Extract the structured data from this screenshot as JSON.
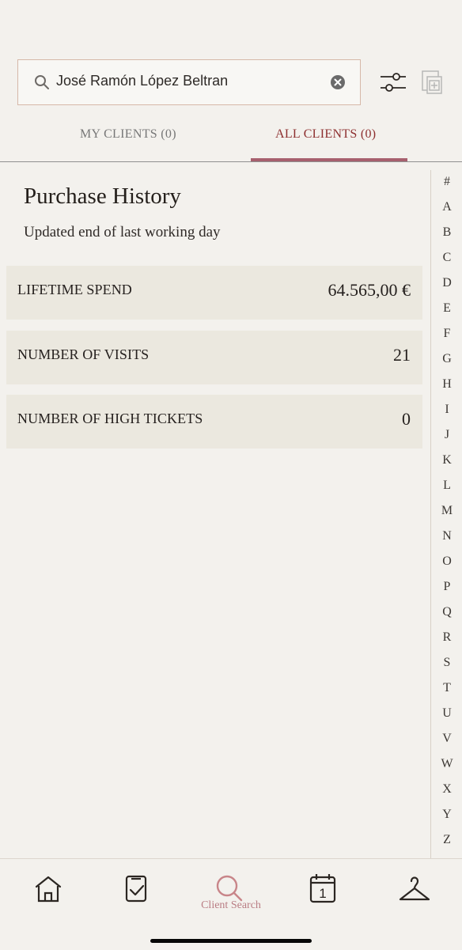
{
  "search": {
    "value": "José Ramón López Beltran"
  },
  "tabs": {
    "my_clients": "MY CLIENTS (0)",
    "all_clients": "ALL CLIENTS (0)"
  },
  "purchase_history": {
    "title": "Purchase History",
    "subtitle": "Updated end of last working day",
    "items": [
      {
        "label": "LIFETIME SPEND",
        "value": "64.565,00 €"
      },
      {
        "label": "NUMBER OF VISITS",
        "value": "21"
      },
      {
        "label": "NUMBER OF HIGH TICKETS",
        "value": "0"
      }
    ]
  },
  "alphabet_index": [
    "#",
    "A",
    "B",
    "C",
    "D",
    "E",
    "F",
    "G",
    "H",
    "I",
    "J",
    "K",
    "L",
    "M",
    "N",
    "O",
    "P",
    "Q",
    "R",
    "S",
    "T",
    "U",
    "V",
    "W",
    "X",
    "Y",
    "Z"
  ],
  "bottom_nav": {
    "items": [
      {
        "icon": "home-icon"
      },
      {
        "icon": "checklist-icon"
      },
      {
        "icon": "search-icon",
        "label": "Client Search"
      },
      {
        "icon": "calendar-icon",
        "date": "1"
      },
      {
        "icon": "hanger-icon"
      }
    ]
  },
  "colors": {
    "background": "#f3f1ed",
    "card": "#ebe8df",
    "accent": "#8d2f2f"
  }
}
